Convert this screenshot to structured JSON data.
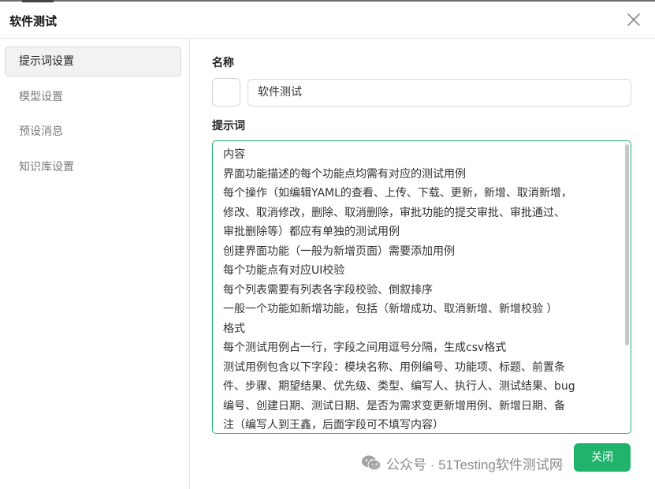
{
  "dialog": {
    "title": "软件测试"
  },
  "sidebar": {
    "items": [
      {
        "label": "提示词设置",
        "active": true
      },
      {
        "label": "模型设置",
        "active": false
      },
      {
        "label": "预设消息",
        "active": false
      },
      {
        "label": "知识库设置",
        "active": false
      }
    ]
  },
  "form": {
    "name_label": "名称",
    "name_value": "软件测试",
    "prompt_label": "提示词",
    "prompt_lines": [
      "内容",
      "界面功能描述的每个功能点均需有对应的测试用例",
      "每个操作（如编辑YAML的查看、上传、下载、更新，新增、取消新增，",
      "修改、取消修改，删除、取消删除，审批功能的提交审批、审批通过、",
      "审批删除等）都应有单独的测试用例",
      "创建界面功能（一般为新增页面）需要添加用例",
      "每个功能点有对应UI校验",
      "每个列表需要有列表各字段校验、倒叙排序",
      "一般一个功能如新增功能，包括（新增成功、取消新增、新增校验 ）",
      "格式",
      "每个测试用例占一行，字段之间用逗号分隔，生成csv格式",
      "测试用例包含以下字段：模块名称、用例编号、功能项、标题、前置条",
      "件、步骤、期望结果、优先级、类型、编写人、执行人、测试结果、bug",
      "编号、创建日期、测试日期、是否为需求变更新增用例、新增日期、备",
      "注（编写人到王鑫，后面字段可不填写内容）"
    ]
  },
  "footer": {
    "close_label": "关闭"
  },
  "watermark": {
    "text": "公众号 · 51Testing软件测试网"
  },
  "colors": {
    "accent": "#1fb36b",
    "focus_border": "#25b36e"
  }
}
